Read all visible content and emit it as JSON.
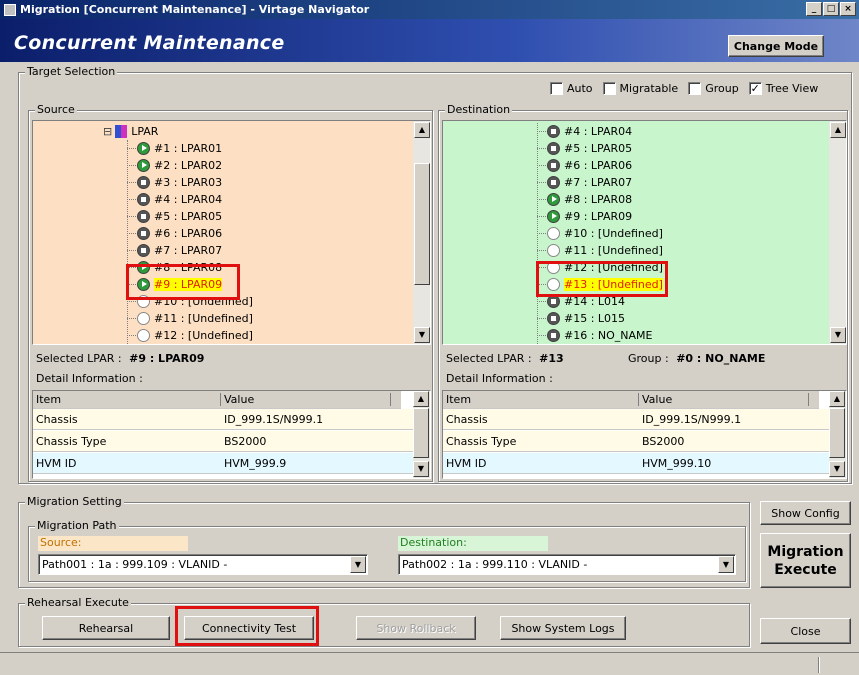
{
  "window": {
    "title": "Migration [Concurrent Maintenance] - Virtage Navigator"
  },
  "header": {
    "title": "Concurrent Maintenance",
    "change_mode_label": "Change Mode"
  },
  "target_selection": {
    "legend": "Target Selection",
    "options": [
      {
        "label": "Auto",
        "checked": false
      },
      {
        "label": "Migratable",
        "checked": false
      },
      {
        "label": "Group",
        "checked": false
      },
      {
        "label": "Tree View",
        "checked": true
      }
    ]
  },
  "source": {
    "legend": "Source",
    "root_label": "LPAR",
    "nodes": [
      {
        "label": "#1 : LPAR01",
        "state": "run"
      },
      {
        "label": "#2 : LPAR02",
        "state": "run"
      },
      {
        "label": "#3 : LPAR03",
        "state": "stop"
      },
      {
        "label": "#4 : LPAR04",
        "state": "stop"
      },
      {
        "label": "#5 : LPAR05",
        "state": "stop"
      },
      {
        "label": "#6 : LPAR06",
        "state": "stop"
      },
      {
        "label": "#7 : LPAR07",
        "state": "stop"
      },
      {
        "label": "#8 : LPAR08",
        "state": "run"
      },
      {
        "label": "#9 : LPAR09",
        "state": "run",
        "selected": true
      },
      {
        "label": "#10 : [Undefined]",
        "state": "undef"
      },
      {
        "label": "#11 : [Undefined]",
        "state": "undef"
      },
      {
        "label": "#12 : [Undefined]",
        "state": "undef"
      }
    ],
    "selected_prefix": "Selected LPAR :",
    "selected_value": "#9 : LPAR09",
    "detail_label": "Detail Information :",
    "grid": {
      "headers": [
        "Item",
        "Value"
      ],
      "rows": [
        [
          "Chassis",
          "ID_999.1S/N999.1"
        ],
        [
          "Chassis Type",
          "BS2000"
        ],
        [
          "HVM ID",
          "HVM_999.9"
        ]
      ]
    }
  },
  "destination": {
    "legend": "Destination",
    "nodes": [
      {
        "label": "#4 : LPAR04",
        "state": "stop"
      },
      {
        "label": "#5 : LPAR05",
        "state": "stop"
      },
      {
        "label": "#6 : LPAR06",
        "state": "stop"
      },
      {
        "label": "#7 : LPAR07",
        "state": "stop"
      },
      {
        "label": "#8 : LPAR08",
        "state": "run"
      },
      {
        "label": "#9 : LPAR09",
        "state": "run"
      },
      {
        "label": "#10 : [Undefined]",
        "state": "undef"
      },
      {
        "label": "#11 : [Undefined]",
        "state": "undef"
      },
      {
        "label": "#12 : [Undefined]",
        "state": "undef"
      },
      {
        "label": "#13 : [Undefined]",
        "state": "undef",
        "selected": true
      },
      {
        "label": "#14 : L014",
        "state": "stop"
      },
      {
        "label": "#15 : L015",
        "state": "stop"
      },
      {
        "label": "#16 : NO_NAME",
        "state": "stop"
      }
    ],
    "selected_prefix": "Selected LPAR :",
    "selected_value": "#13",
    "group_prefix": "Group :",
    "group_value": "#0 : NO_NAME",
    "detail_label": "Detail Information :",
    "grid": {
      "headers": [
        "Item",
        "Value"
      ],
      "rows": [
        [
          "Chassis",
          "ID_999.1S/N999.1"
        ],
        [
          "Chassis Type",
          "BS2000"
        ],
        [
          "HVM ID",
          "HVM_999.10"
        ]
      ]
    }
  },
  "migration_setting": {
    "legend": "Migration Setting",
    "path_legend": "Migration Path",
    "source_label": "Source:",
    "source_value": "Path001 : 1a : 999.109 : VLANID -",
    "destination_label": "Destination:",
    "destination_value": "Path002 : 1a : 999.110 : VLANID -"
  },
  "rehearsal": {
    "legend": "Rehearsal Execute",
    "rehearsal_label": "Rehearsal",
    "connectivity_label": "Connectivity Test",
    "rollback_label": "Show Rollback",
    "logs_label": "Show System Logs"
  },
  "side_buttons": {
    "show_config": "Show Config",
    "migration_execute": "Migration Execute",
    "close": "Close"
  },
  "colors": {
    "source_bg": "#fde0c4",
    "destination_bg": "#c8f5cc",
    "grid_row_alt": "#fffbe6",
    "grid_row_hvm": "#e3f8ff",
    "highlight": "#ffff00",
    "annotation_red": "#e01010"
  }
}
